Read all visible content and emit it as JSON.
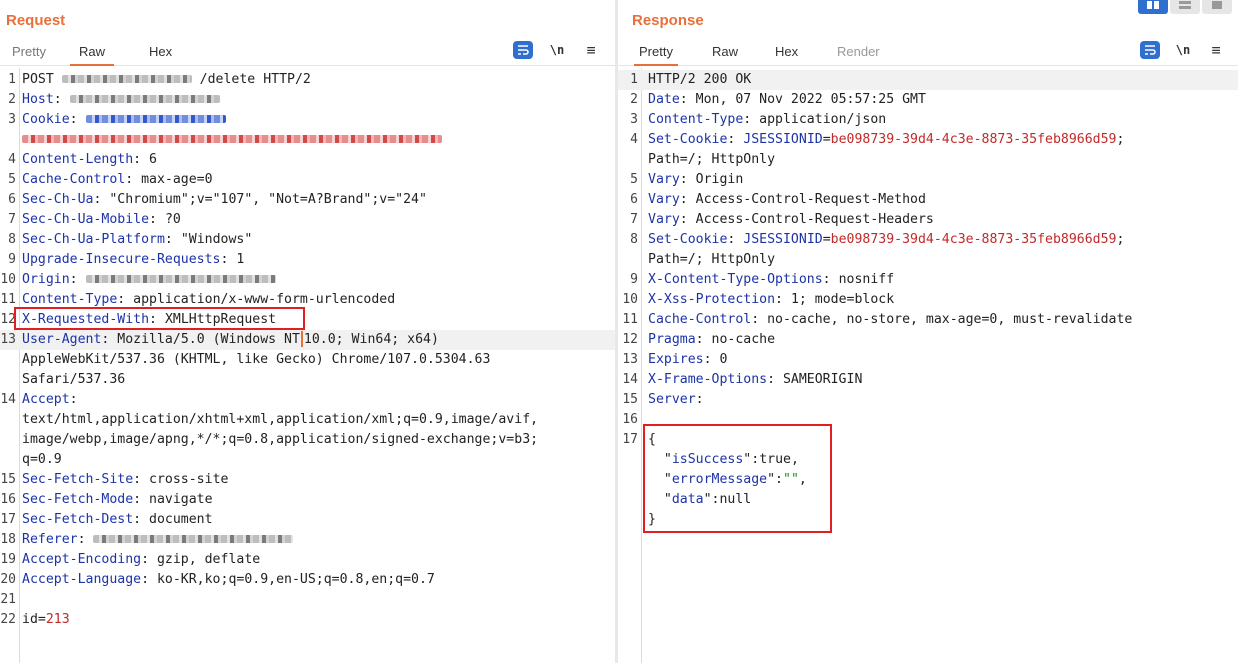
{
  "request": {
    "title": "Request",
    "tabs": [
      "Pretty",
      "Raw",
      "Hex"
    ],
    "active_tab": "Raw",
    "lines": [
      {
        "n": "1",
        "t": "POST"
      },
      {
        "n": "2",
        "k": "Host"
      },
      {
        "n": "3",
        "k": "Cookie"
      },
      {
        "n": "",
        "t": ""
      },
      {
        "n": "4",
        "k": "Content-Length",
        "v": "6"
      },
      {
        "n": "5",
        "k": "Cache-Control",
        "v": "max-age=0"
      },
      {
        "n": "6",
        "k": "Sec-Ch-Ua",
        "v": "\"Chromium\";v=\"107\", \"Not=A?Brand\";v=\"24\""
      },
      {
        "n": "7",
        "k": "Sec-Ch-Ua-Mobile",
        "v": "?0"
      },
      {
        "n": "8",
        "k": "Sec-Ch-Ua-Platform",
        "v": "\"Windows\""
      },
      {
        "n": "9",
        "k": "Upgrade-Insecure-Requests",
        "v": "1"
      },
      {
        "n": "10",
        "k": "Origin"
      },
      {
        "n": "11",
        "k": "Content-Type",
        "v": "application/x-www-form-urlencoded"
      },
      {
        "n": "12",
        "k": "X-Requested-With",
        "v": "XMLHttpRequest"
      },
      {
        "n": "13",
        "k": "User-Agent",
        "v": "Mozilla/5.0 (Windows NT",
        "v2": "10.0; Win64; x64)"
      },
      {
        "n": "",
        "t": "AppleWebKit/537.36 (KHTML, like Gecko) Chrome/107.0.5304.63"
      },
      {
        "n": "",
        "t": "Safari/537.36"
      },
      {
        "n": "14",
        "k": "Accept"
      },
      {
        "n": "",
        "t": "text/html,application/xhtml+xml,application/xml;q=0.9,image/avif,"
      },
      {
        "n": "",
        "t": "image/webp,image/apng,*/*;q=0.8,application/signed-exchange;v=b3;"
      },
      {
        "n": "",
        "t": "q=0.9"
      },
      {
        "n": "15",
        "k": "Sec-Fetch-Site",
        "v": "cross-site"
      },
      {
        "n": "16",
        "k": "Sec-Fetch-Mode",
        "v": "navigate"
      },
      {
        "n": "17",
        "k": "Sec-Fetch-Dest",
        "v": "document"
      },
      {
        "n": "18",
        "k": "Referer"
      },
      {
        "n": "19",
        "k": "Accept-Encoding",
        "v": "gzip, deflate"
      },
      {
        "n": "20",
        "k": "Accept-Language",
        "v": "ko-KR,ko;q=0.9,en-US;q=0.8,en;q=0.7"
      },
      {
        "n": "21",
        "t": ""
      },
      {
        "n": "22",
        "t": "id="
      }
    ],
    "delete_path": "/delete HTTP/2",
    "body_value": "213"
  },
  "response": {
    "title": "Response",
    "tabs": [
      "Pretty",
      "Raw",
      "Hex",
      "Render"
    ],
    "active_tab": "Pretty",
    "lines": [
      {
        "n": "1",
        "t": "HTTP/2 200 OK"
      },
      {
        "n": "2",
        "k": "Date",
        "v": "Mon, 07 Nov 2022 05:57:25 GMT"
      },
      {
        "n": "3",
        "k": "Content-Type",
        "v": "application/json"
      },
      {
        "n": "4",
        "k": "Set-Cookie",
        "c": "JSESSIONID",
        "r": "be098739-39d4-4c3e-8873-35feb8966d59",
        "e": ";"
      },
      {
        "n": "",
        "t": "Path=/; HttpOnly"
      },
      {
        "n": "5",
        "k": "Vary",
        "v": "Origin"
      },
      {
        "n": "6",
        "k": "Vary",
        "v": "Access-Control-Request-Method"
      },
      {
        "n": "7",
        "k": "Vary",
        "v": "Access-Control-Request-Headers"
      },
      {
        "n": "8",
        "k": "Set-Cookie",
        "c": "JSESSIONID",
        "r": "be098739-39d4-4c3e-8873-35feb8966d59",
        "e": ";"
      },
      {
        "n": "",
        "t": "Path=/; HttpOnly"
      },
      {
        "n": "9",
        "k": "X-Content-Type-Options",
        "v": "nosniff"
      },
      {
        "n": "10",
        "k": "X-Xss-Protection",
        "v": "1; mode=block"
      },
      {
        "n": "11",
        "k": "Cache-Control",
        "v": "no-cache, no-store, max-age=0, must-revalidate"
      },
      {
        "n": "12",
        "k": "Pragma",
        "v": "no-cache"
      },
      {
        "n": "13",
        "k": "Expires",
        "v": "0"
      },
      {
        "n": "14",
        "k": "X-Frame-Options",
        "v": "SAMEORIGIN"
      },
      {
        "n": "15",
        "k": "Server",
        "v": ""
      },
      {
        "n": "16",
        "t": ""
      },
      {
        "n": "17",
        "t": "{"
      },
      {
        "n": "",
        "j": "isSuccess",
        "jv": "true",
        "jt": "bool"
      },
      {
        "n": "",
        "j": "errorMessage",
        "jv": "\"\"",
        "jt": "str"
      },
      {
        "n": "",
        "j": "data",
        "jv": "null",
        "jt": "last"
      },
      {
        "n": "",
        "t": "}"
      }
    ]
  },
  "toolbar": {
    "wrap_icon": "wrap-lines-icon",
    "newline_label": "\\n",
    "menu_icon": "menu-icon"
  }
}
